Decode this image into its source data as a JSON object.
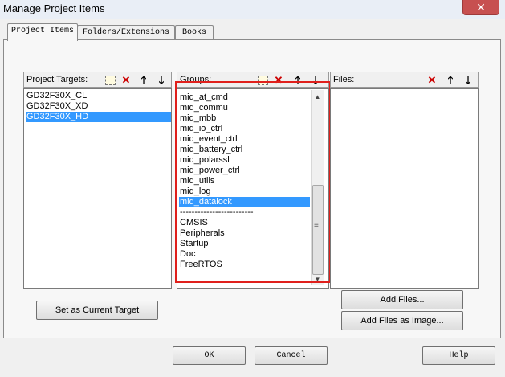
{
  "window": {
    "title": "Manage Project Items",
    "close_glyph": "✕"
  },
  "tabs": [
    {
      "label": "Project Items"
    },
    {
      "label": "Folders/Extensions"
    },
    {
      "label": "Books"
    }
  ],
  "targets": {
    "label": "Project Targets:",
    "items": [
      "GD32F30X_CL",
      "GD32F30X_XD",
      "GD32F30X_HD"
    ],
    "selected": "GD32F30X_HD"
  },
  "groups": {
    "label": "Groups:",
    "items": [
      "mid_at_cmd",
      "mid_commu",
      "mid_mbb",
      "mid_io_ctrl",
      "mid_event_ctrl",
      "mid_battery_ctrl",
      "mid_polarssl",
      "mid_power_ctrl",
      "mid_utils",
      "mid_log",
      "mid_datalock",
      "-------------------------",
      "CMSIS",
      "Peripherals",
      "Startup",
      "Doc",
      "FreeRTOS"
    ],
    "selected": "mid_datalock"
  },
  "files": {
    "label": "Files:"
  },
  "icons": {
    "new": "new-icon",
    "delete": "delete-icon",
    "up": "arrow-up-icon",
    "down": "arrow-down-icon"
  },
  "glyphs": {
    "delete": "✕",
    "up": "🡑",
    "down": "🡓",
    "sb_up": "▲",
    "sb_down": "▼",
    "sb_grip": "≡"
  },
  "buttons": {
    "set_current_target": "Set as Current Target",
    "add_files": "Add Files...",
    "add_files_image": "Add Files as Image...",
    "ok": "OK",
    "cancel": "Cancel",
    "help": "Help"
  },
  "colors": {
    "selection": "#3399ff",
    "highlight_frame": "#e0201c",
    "delete_icon": "#cc0000"
  }
}
